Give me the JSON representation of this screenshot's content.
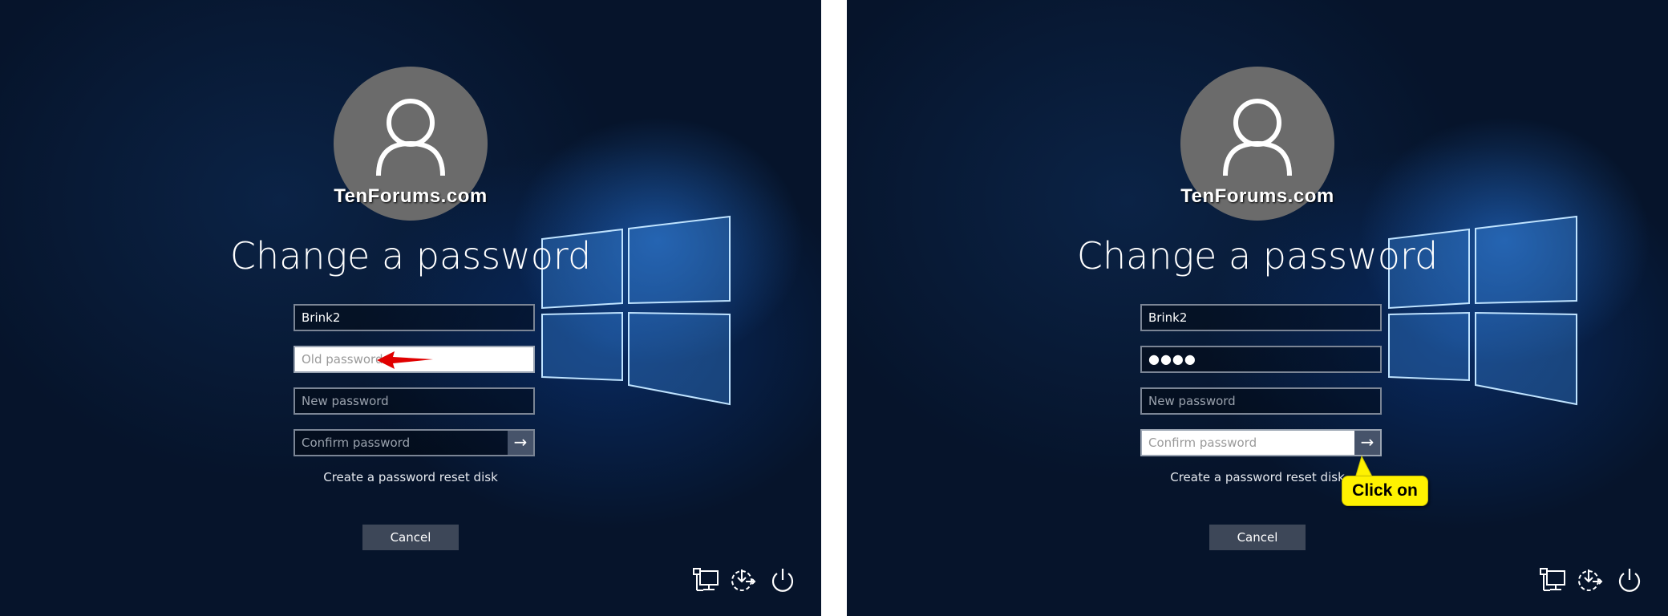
{
  "watermark": "TenForums.com",
  "colors": {
    "accent_callout": "#fff200",
    "arrow_red": "#e00000",
    "background": "#06142b"
  },
  "panels": [
    {
      "title": "Change a password",
      "username": "Brink2",
      "old_password_placeholder": "Old password",
      "new_password_placeholder": "New password",
      "confirm_password_placeholder": "Confirm password",
      "reset_disk_link": "Create a password reset disk",
      "cancel_label": "Cancel",
      "focused_field": "old_password"
    },
    {
      "title": "Change a password",
      "username": "Brink2",
      "old_password_value": "●●●●",
      "new_password_placeholder": "New password",
      "confirm_password_placeholder": "Confirm password",
      "reset_disk_link": "Create a password reset disk",
      "cancel_label": "Cancel",
      "focused_field": "confirm_password",
      "callout": "Click on"
    }
  ],
  "icons": [
    "network-icon",
    "ease-of-access-icon",
    "power-icon"
  ]
}
